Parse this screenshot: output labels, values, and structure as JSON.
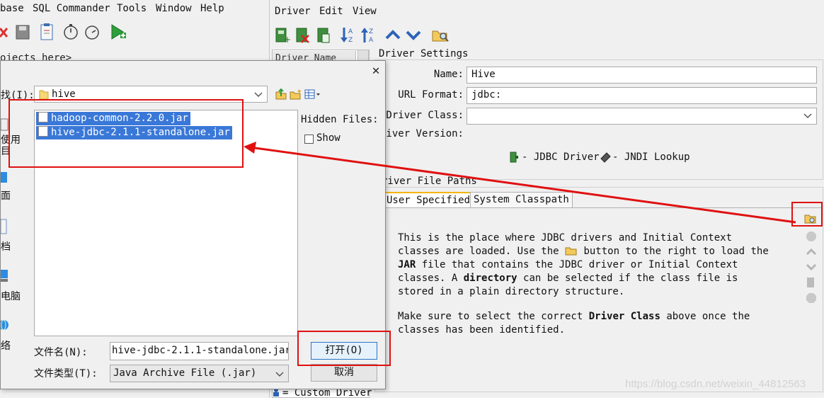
{
  "left_app": {
    "menu": [
      "base",
      "SQL Commander",
      "Tools",
      "Window",
      "Help"
    ],
    "objects_hint": "ojects here>"
  },
  "right_app": {
    "menu": [
      "Driver",
      "Edit",
      "View"
    ],
    "driver_list_header": "Driver Name",
    "settings_title": "Driver Settings",
    "name_label": "Name:",
    "name_value": "Hive",
    "url_label": "URL Format:",
    "url_value": "jdbc:",
    "class_label": "Driver Class:",
    "class_value": "",
    "version_label": "river Version:",
    "legend_jdbc": "- JDBC Driver",
    "legend_jndi": "- JNDI Lookup",
    "paths_title": "river File Paths",
    "tabs": [
      "User Specified",
      "System Classpath"
    ],
    "help_para1_parts": [
      "This is the place where JDBC drivers and Initial Context classes are loaded. Use the",
      "button to the right to load the",
      "JAR",
      "file that contains the JDBC driver or Initial Context classes. A",
      "directory",
      "can be selected if the class file is stored in a plain directory structure."
    ],
    "help_para2_parts": [
      "Make sure to select the correct",
      "Driver Class",
      "above once the classes has been identified."
    ],
    "footer_legend": "= Custom Driver",
    "watermark": "https://blog.csdn.net/weixin_44812563"
  },
  "dialog": {
    "lookin_label": "找(I):",
    "lookin_value": "hive",
    "files": [
      "hadoop-common-2.2.0.jar",
      "hive-jdbc-2.1.1-standalone.jar"
    ],
    "hidden_files_label": "Hidden Files:",
    "show_label": "Show",
    "shortcuts": [
      "使用\n目",
      "面",
      "档",
      "电脑",
      "络"
    ],
    "filename_label": "文件名(N):",
    "filename_value": "hive-jdbc-2.1.1-standalone.jar\"",
    "filetype_label": "文件类型(T):",
    "filetype_value": "Java Archive File (.jar)",
    "open_button": "打开(O)",
    "cancel_button": "取消"
  },
  "colors": {
    "selection": "#3a78d8",
    "annotation_red": "#e01010",
    "window_bg": "#f0f0f0"
  }
}
